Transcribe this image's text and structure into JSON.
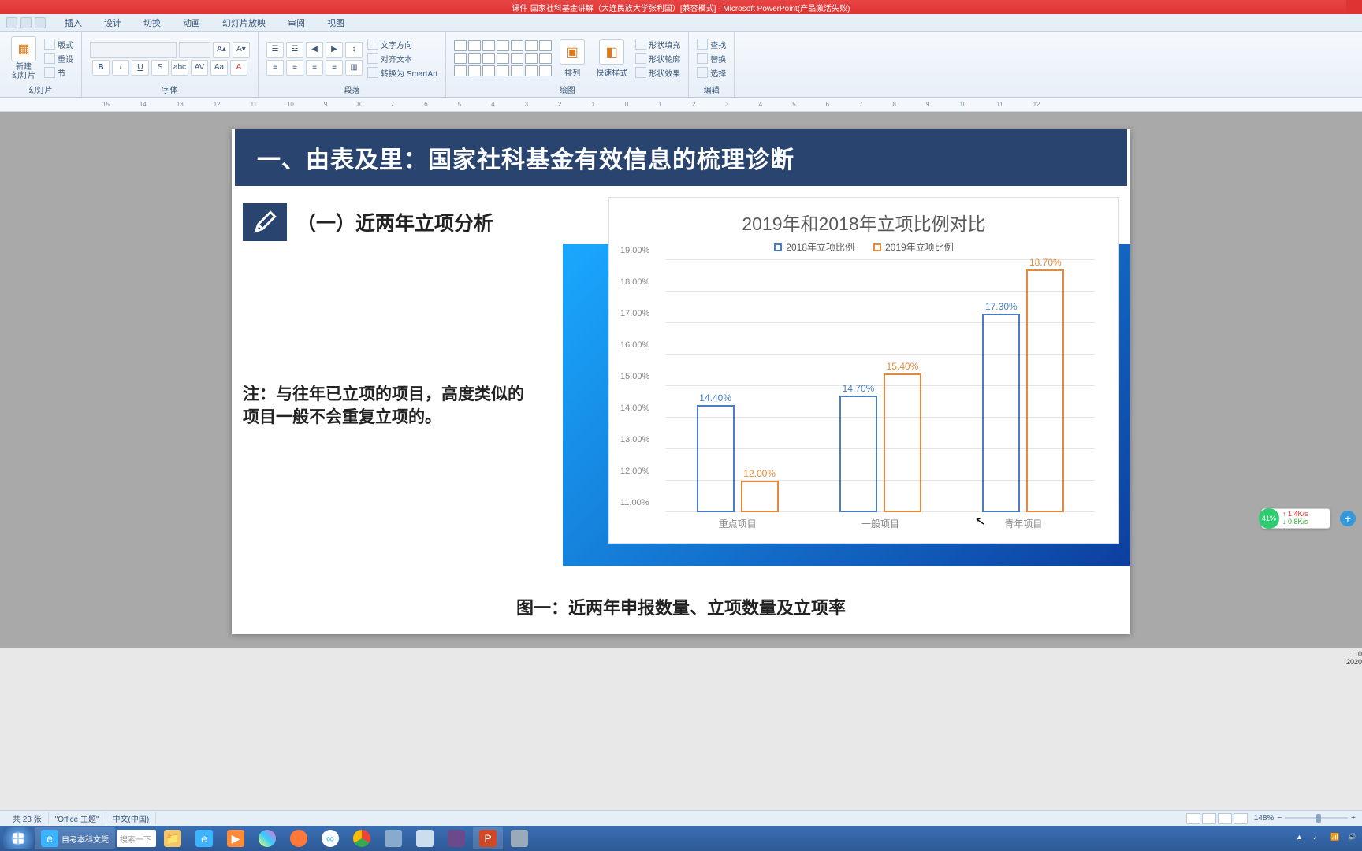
{
  "titlebar": "课件·国家社科基金讲解（大连民族大学张利国）[兼容模式]  -  Microsoft PowerPoint(产品激活失败)",
  "tabs": [
    "插入",
    "设计",
    "切换",
    "动画",
    "幻灯片放映",
    "审阅",
    "视图"
  ],
  "groups": {
    "slide": {
      "new": "新建\n幻灯片",
      "layout": "版式",
      "reset": "重设",
      "section": "节",
      "label": "幻灯片"
    },
    "font": {
      "label": "字体"
    },
    "para": {
      "textdir": "文字方向",
      "align": "对齐文本",
      "smartart": "转换为 SmartArt",
      "label": "段落"
    },
    "draw": {
      "arrange": "排列",
      "quick": "快速样式",
      "fill": "形状填充",
      "outline": "形状轮廓",
      "effects": "形状效果",
      "label": "绘图"
    },
    "edit": {
      "find": "查找",
      "replace": "替换",
      "select": "选择",
      "label": "编辑"
    }
  },
  "ruler_marks": [
    "15",
    "14",
    "13",
    "12",
    "11",
    "10",
    "9",
    "8",
    "7",
    "6",
    "5",
    "4",
    "3",
    "2",
    "1",
    "0",
    "1",
    "2",
    "3",
    "4",
    "5",
    "6",
    "7",
    "8",
    "9",
    "10",
    "11",
    "12"
  ],
  "slide": {
    "header": "一、由表及里：国家社科基金有效信息的梳理诊断",
    "section_title": "（一）近两年立项分析",
    "note": "注：与往年已立项的项目，高度类似的项目一般不会重复立项的。",
    "caption": "图一：近两年申报数量、立项数量及立项率"
  },
  "chart_data": {
    "type": "bar",
    "title": "2019年和2018年立项比例对比",
    "series": [
      {
        "name": "2018年立项比例",
        "values": [
          14.4,
          14.7,
          17.3
        ],
        "color": "#4a7ec4"
      },
      {
        "name": "2019年立项比例",
        "values": [
          12.0,
          15.4,
          18.7
        ],
        "color": "#e58a3a"
      }
    ],
    "categories": [
      "重点项目",
      "一般项目",
      "青年项目"
    ],
    "ylabel": "",
    "xlabel": "",
    "ylim": [
      11,
      19
    ],
    "yticks": [
      "11.00%",
      "12.00%",
      "13.00%",
      "14.00%",
      "15.00%",
      "16.00%",
      "17.00%",
      "18.00%",
      "19.00%"
    ],
    "value_labels": [
      [
        "14.40%",
        "12.00%"
      ],
      [
        "14.70%",
        "15.40%"
      ],
      [
        "17.30%",
        "18.70%"
      ]
    ]
  },
  "status": {
    "slides": "共 23 张",
    "theme": "\"Office 主题\"",
    "lang": "中文(中国)",
    "zoom": "148%"
  },
  "taskbar": {
    "ie": "自考本科文凭",
    "search": "搜索一下"
  },
  "widgets": {
    "battery": "41%",
    "up": "1.4K/s",
    "down": "0.8K/s",
    "time": "10",
    "date": "2020"
  }
}
